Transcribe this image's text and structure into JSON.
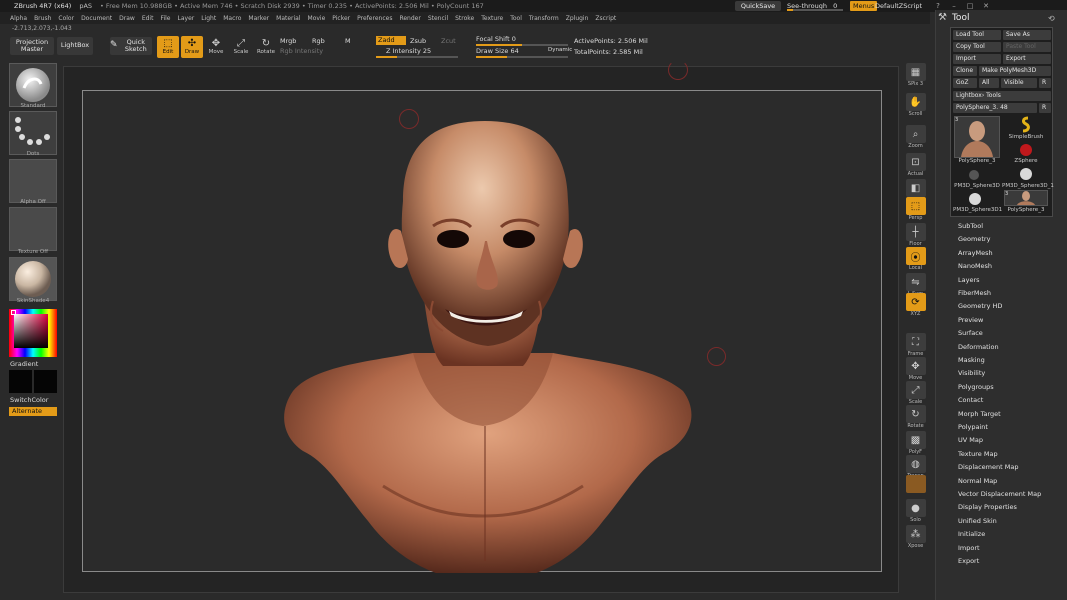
{
  "titlebar": {
    "app": "ZBrush 4R7 (x64)",
    "project": "pAS",
    "mem": "• Free Mem 10.988GB • Active Mem 746 • Scratch Disk 2939 • Timer 0.235 • ActivePoints: 2.506 Mil • PolyCount 167",
    "quicksave": "QuickSave",
    "see_through": "See-through",
    "see_through_value": "0",
    "see_through_level": 0,
    "menus": "Menus",
    "default_script": "DefaultZScript"
  },
  "menubar": {
    "items": [
      "Alpha",
      "Brush",
      "Color",
      "Document",
      "Draw",
      "Edit",
      "File",
      "Layer",
      "Light",
      "Macro",
      "Marker",
      "Material",
      "Movie",
      "Picker",
      "Preferences",
      "Render",
      "Stencil",
      "Stroke",
      "Texture",
      "Tool",
      "Transform",
      "Zplugin",
      "Zscript"
    ]
  },
  "coords": "-2.713,2.073,-1.043",
  "shelf": {
    "projection_master": "Projection Master",
    "lightbox": "LightBox",
    "quick_sketch": "Quick Sketch",
    "edit": "Edit",
    "draw": "Draw",
    "move": "Move",
    "scale": "Scale",
    "rotate": "Rotate",
    "mrgb": "Mrgb",
    "rgb": "Rgb",
    "m": "M",
    "rgb_intensity": "Rgb Intensity",
    "zadd": "Zadd",
    "zsub": "Zsub",
    "zcut": "Zcut",
    "z_intensity": "Z Intensity 25",
    "z_intensity_level": 25,
    "focal_shift": "Focal Shift 0",
    "draw_size": "Draw Size 64",
    "draw_size_level": 0.34,
    "dynamic": "Dynamic",
    "active_points": "ActivePoints: 2.506 Mil",
    "total_points": "TotalPoints: 2.585 Mil"
  },
  "left": {
    "brush_caption": "Standard",
    "stroke_caption": "Dots",
    "alpha_caption": "Alpha Off",
    "texture_caption": "Texture Off",
    "material_caption": "SkinShade4",
    "gradient": "Gradient",
    "switch_color": "SwitchColor",
    "alternate": "Alternate"
  },
  "right_shelf": [
    {
      "name": "spix",
      "label": "SPix 3",
      "icon": "spix-icon",
      "glyph": "▦"
    },
    {
      "name": "scroll",
      "label": "Scroll",
      "icon": "hand-icon",
      "glyph": "✋"
    },
    {
      "name": "zoom",
      "label": "Zoom",
      "icon": "magnifier-icon",
      "glyph": "⌕"
    },
    {
      "name": "actual",
      "label": "Actual",
      "icon": "actual-icon",
      "glyph": "⊡"
    },
    {
      "name": "aahalf",
      "label": "AAHalf",
      "icon": "aahalf-icon",
      "glyph": "◧"
    },
    {
      "name": "persp",
      "label": "Persp",
      "icon": "persp-icon",
      "glyph": "⬚"
    },
    {
      "name": "floor",
      "label": "Floor",
      "icon": "floor-icon",
      "glyph": "┼"
    },
    {
      "name": "local",
      "label": "Local",
      "icon": "local-icon",
      "glyph": "⦿"
    },
    {
      "name": "lsym",
      "label": "L.Sym",
      "icon": "lsym-icon",
      "glyph": "⇋"
    },
    {
      "name": "xyz",
      "label": "XYZ",
      "icon": "xyz-icon",
      "glyph": "⟳"
    },
    {
      "name": "frame",
      "label": "Frame",
      "icon": "frame-icon",
      "glyph": "⛶"
    },
    {
      "name": "move",
      "label": "Move",
      "icon": "move-icon",
      "glyph": "✥"
    },
    {
      "name": "scale",
      "label": "Scale",
      "icon": "scale-icon",
      "glyph": "⤢"
    },
    {
      "name": "rotate",
      "label": "Rotate",
      "icon": "rotate-icon",
      "glyph": "↻"
    },
    {
      "name": "polyf",
      "label": "PolyF",
      "icon": "polyframe-icon",
      "glyph": "▩"
    },
    {
      "name": "transp",
      "label": "Transp",
      "icon": "transparency-icon",
      "glyph": "◍"
    },
    {
      "name": "ghost",
      "label": "",
      "icon": "ghost-icon",
      "glyph": ""
    },
    {
      "name": "solo",
      "label": "Solo",
      "icon": "solo-icon",
      "glyph": "●"
    },
    {
      "name": "xpose",
      "label": "Xpose",
      "icon": "xpose-icon",
      "glyph": "⁂"
    }
  ],
  "tool": {
    "title": "Tool",
    "load_tool": "Load Tool",
    "save_as": "Save As",
    "copy_tool": "Copy Tool",
    "paste_tool": "Paste Tool",
    "import": "Import",
    "export": "Export",
    "clone": "Clone",
    "make_polymesh": "Make PolyMesh3D",
    "goz": "GoZ",
    "all": "All",
    "visible": "Visible",
    "r": "R",
    "lightbox_tools": "Lightbox› Tools",
    "current": "PolySphere_3. 48",
    "thumbs": [
      {
        "caption": "PolySphere_3",
        "count": "3"
      },
      {
        "caption": "SimpleBrush",
        "count": ""
      },
      {
        "caption": "ZSphere",
        "count": ""
      },
      {
        "caption": "PM3D_Sphere3D",
        "count": ""
      },
      {
        "caption": "PM3D_Sphere3D_1",
        "count": ""
      },
      {
        "caption": "PM3D_Sphere3D1",
        "count": ""
      },
      {
        "caption": "PolySphere_3",
        "count": "3"
      }
    ],
    "sections": [
      "SubTool",
      "Geometry",
      "ArrayMesh",
      "NanoMesh",
      "Layers",
      "FiberMesh",
      "Geometry HD",
      "Preview",
      "Surface",
      "Deformation",
      "Masking",
      "Visibility",
      "Polygroups",
      "Contact",
      "Morph Target",
      "Polypaint",
      "UV Map",
      "Texture Map",
      "Displacement Map",
      "Normal Map",
      "Vector Displacement Map",
      "Display Properties",
      "Unified Skin",
      "Initialize",
      "Import",
      "Export"
    ]
  },
  "colors": {
    "accent": "#e39b18",
    "panel": "#2a2a2a",
    "canvas": "#242424"
  }
}
